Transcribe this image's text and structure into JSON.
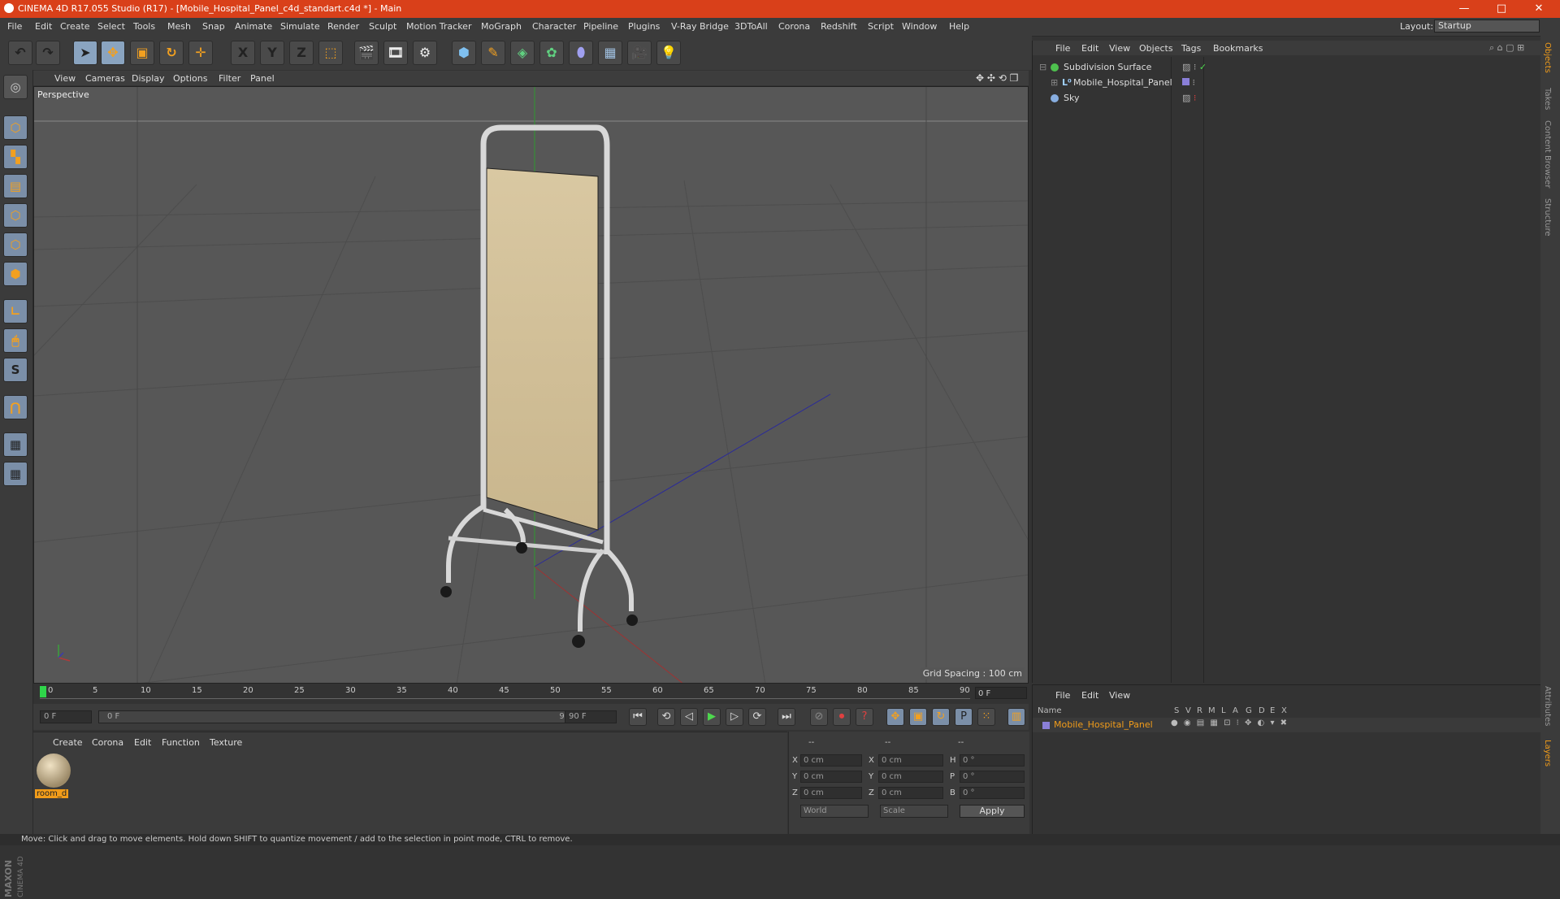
{
  "window": {
    "title": "CINEMA 4D R17.055 Studio (R17) - [Mobile_Hospital_Panel_c4d_standart.c4d *] - Main",
    "controls": [
      "—",
      "□",
      "✕"
    ]
  },
  "menubar": {
    "items": [
      "File",
      "Edit",
      "Create",
      "Select",
      "Tools",
      "Mesh",
      "Snap",
      "Animate",
      "Simulate",
      "Render",
      "Sculpt",
      "Motion Tracker",
      "MoGraph",
      "Character",
      "Pipeline",
      "Plugins",
      "V-Ray Bridge",
      "3DToAll",
      "Corona",
      "Redshift",
      "Script",
      "Window",
      "Help"
    ],
    "layout_label": "Layout:",
    "layout_value": "Startup"
  },
  "toolbar": {
    "axis_labels": [
      "X",
      "Y",
      "Z"
    ]
  },
  "viewport": {
    "menu": [
      "View",
      "Cameras",
      "Display",
      "Options",
      "Filter",
      "Panel"
    ],
    "label": "Perspective",
    "grid_spacing": "Grid Spacing : 100 cm"
  },
  "timeline": {
    "ticks": [
      "0",
      "5",
      "10",
      "15",
      "20",
      "25",
      "30",
      "35",
      "40",
      "45",
      "50",
      "55",
      "60",
      "65",
      "70",
      "75",
      "80",
      "85",
      "90"
    ],
    "current_frame": "0 F",
    "start_field": "0 F",
    "range_start": "0 F",
    "range_end": "90 F",
    "end_field": "90 F"
  },
  "material_manager": {
    "menu": [
      "Create",
      "Corona",
      "Edit",
      "Function",
      "Texture"
    ],
    "material_name": "room_d"
  },
  "coordinates": {
    "headers": [
      "--",
      "--",
      "--"
    ],
    "rows": [
      {
        "a": "X",
        "av": "0 cm",
        "b": "X",
        "bv": "0 cm",
        "c": "H",
        "cv": "0 °"
      },
      {
        "a": "Y",
        "av": "0 cm",
        "b": "Y",
        "bv": "0 cm",
        "c": "P",
        "cv": "0 °"
      },
      {
        "a": "Z",
        "av": "0 cm",
        "b": "Z",
        "bv": "0 cm",
        "c": "B",
        "cv": "0 °"
      }
    ],
    "mode1": "World",
    "mode2": "Scale",
    "apply": "Apply"
  },
  "object_manager": {
    "menu": [
      "File",
      "Edit",
      "View",
      "Objects",
      "Tags",
      "Bookmarks"
    ],
    "objects": [
      "Subdivision Surface",
      "Mobile_Hospital_Panel",
      "Sky"
    ]
  },
  "layer_manager": {
    "menu": [
      "File",
      "Edit",
      "View"
    ],
    "name_header": "Name",
    "columns": [
      "S",
      "V",
      "R",
      "M",
      "L",
      "A",
      "G",
      "D",
      "E",
      "X"
    ],
    "layer_name": "Mobile_Hospital_Panel"
  },
  "right_tabs": [
    "Objects",
    "Takes",
    "Content Browser",
    "Structure",
    "Attributes",
    "Layers"
  ],
  "status": "Move: Click and drag to move elements. Hold down SHIFT to quantize movement / add to the selection in point mode, CTRL to remove.",
  "brand": {
    "maxon": "MAXON",
    "product": "CINEMA 4D"
  },
  "colors": {
    "title_bar": "#d9401a",
    "highlight": "#f19c1a",
    "viewport": "#575757"
  }
}
